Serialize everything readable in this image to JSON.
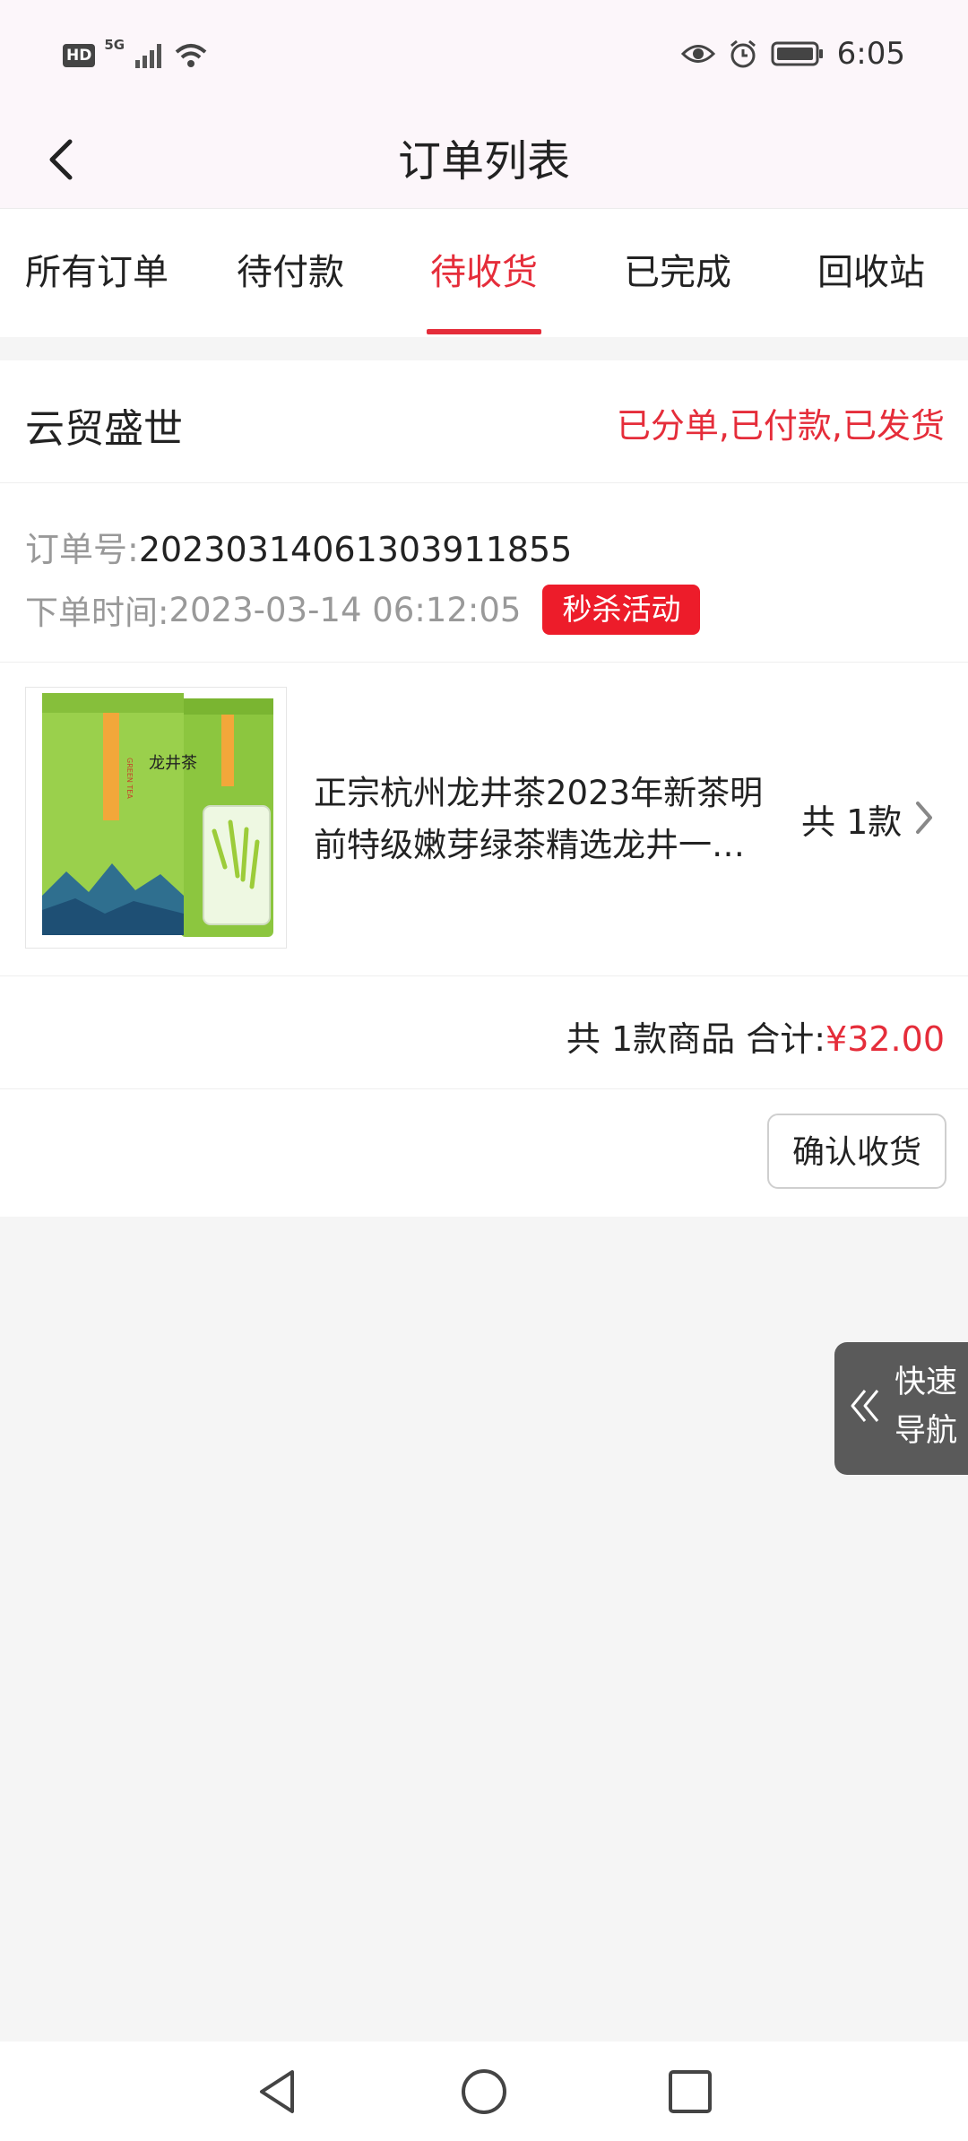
{
  "status_bar": {
    "hd_badge": "HD",
    "network": "5G",
    "time": "6:05",
    "icons": [
      "signal-icon",
      "wifi-icon",
      "eye-icon",
      "alarm-icon",
      "battery-icon"
    ]
  },
  "header": {
    "title": "订单列表"
  },
  "tabs": [
    {
      "label": "所有订单",
      "active": false
    },
    {
      "label": "待付款",
      "active": false
    },
    {
      "label": "待收货",
      "active": true
    },
    {
      "label": "已完成",
      "active": false
    },
    {
      "label": "回收站",
      "active": false
    }
  ],
  "order": {
    "shop_name": "云贸盛世",
    "status": "已分单,已付款,已发货",
    "order_no_label": "订单号:",
    "order_no": "20230314061303911855",
    "time_label": "下单时间:",
    "time": "2023-03-14 06:12:05",
    "badge": "秒杀活动",
    "product": {
      "title_line1": "正宗杭州龙井茶2023年新茶明",
      "title_line2": "前特级嫩芽绿茶精选龙井一…",
      "count": "共 1款",
      "image_text": {
        "cn": "龙井茶",
        "en": "GREEN TEA"
      }
    },
    "summary_prefix": "共 1款商品 合计:",
    "total": "¥32.00",
    "confirm_button": "确认收货"
  },
  "quick_nav": {
    "label": "快速导航"
  },
  "colors": {
    "accent": "#e52d3a",
    "badge": "#ed1c2a",
    "quick_nav_bg": "#5a5a5a"
  }
}
